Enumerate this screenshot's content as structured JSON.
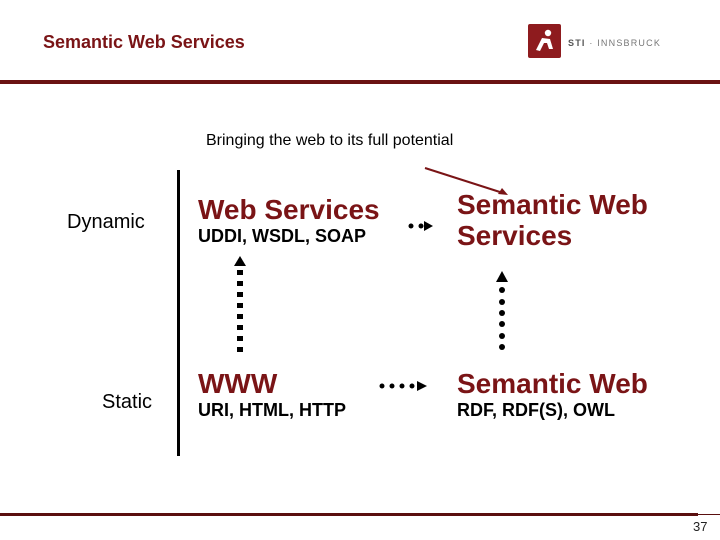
{
  "header": {
    "title": "Semantic Web Services",
    "logo": {
      "icon": "sti-runner-logo-icon",
      "brand": "STI",
      "separator": "·",
      "location": "INNSBRUCK"
    }
  },
  "colors": {
    "accent": "#7a1416",
    "logo_bg": "#8e1b1e",
    "text": "#000000"
  },
  "subtitle": "Bringing the web to its full potential",
  "axis": {
    "dynamic": "Dynamic",
    "static": "Static"
  },
  "boxes": {
    "web_services": {
      "title": "Web Services",
      "sub": "UDDI, WSDL, SOAP"
    },
    "semantic_web_services": {
      "title_line1": "Semantic Web",
      "title_line2": "Services"
    },
    "www": {
      "title": "WWW",
      "sub": "URI, HTML, HTTP"
    },
    "semantic_web": {
      "title": "Semantic Web",
      "sub": "RDF, RDF(S), OWL"
    }
  },
  "footer": {
    "page_number": "37"
  }
}
